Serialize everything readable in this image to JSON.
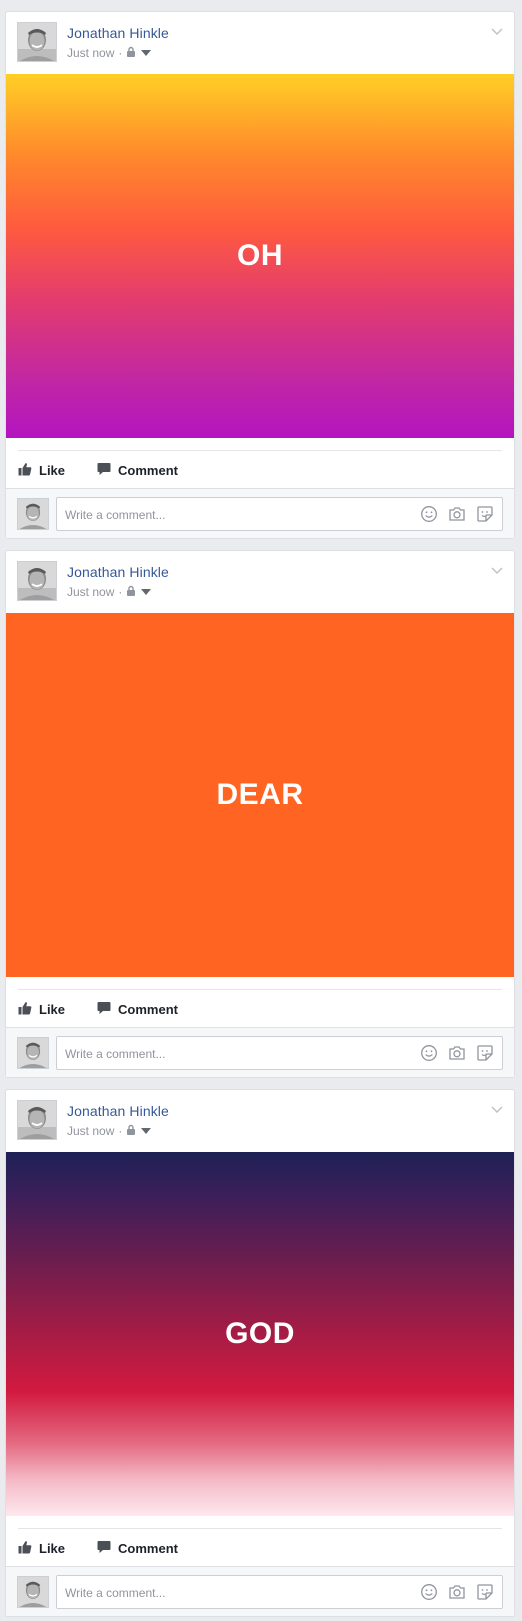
{
  "colors": {
    "background": "#e9ebee",
    "author_link": "#365899",
    "muted": "#90949c"
  },
  "posts": [
    {
      "author": "Jonathan Hinkle",
      "timestamp": "Just now",
      "separator": "·",
      "media_text": "OH",
      "media_background": "linear-gradient(180deg,#ffcf26 0%,#ff8a2b 22%,#ff5b3e 42%,#e33c6e 62%,#c026a5 85%,#b414c0 100%)",
      "actions": {
        "like": "Like",
        "comment": "Comment"
      },
      "comment_placeholder": "Write a comment..."
    },
    {
      "author": "Jonathan Hinkle",
      "timestamp": "Just now",
      "separator": "·",
      "media_text": "DEAR",
      "media_background": "#ff6422",
      "actions": {
        "like": "Like",
        "comment": "Comment"
      },
      "comment_placeholder": "Write a comment..."
    },
    {
      "author": "Jonathan Hinkle",
      "timestamp": "Just now",
      "separator": "·",
      "media_text": "GOD",
      "media_background": "linear-gradient(180deg,#1e2156 0%,#3c1f5a 12%,#6c1e4e 30%,#a61c45 50%,#d31a40 66%,#e46a82 80%,#f4b9c6 90%,#fde8ee 100%)",
      "actions": {
        "like": "Like",
        "comment": "Comment"
      },
      "comment_placeholder": "Write a comment..."
    }
  ]
}
